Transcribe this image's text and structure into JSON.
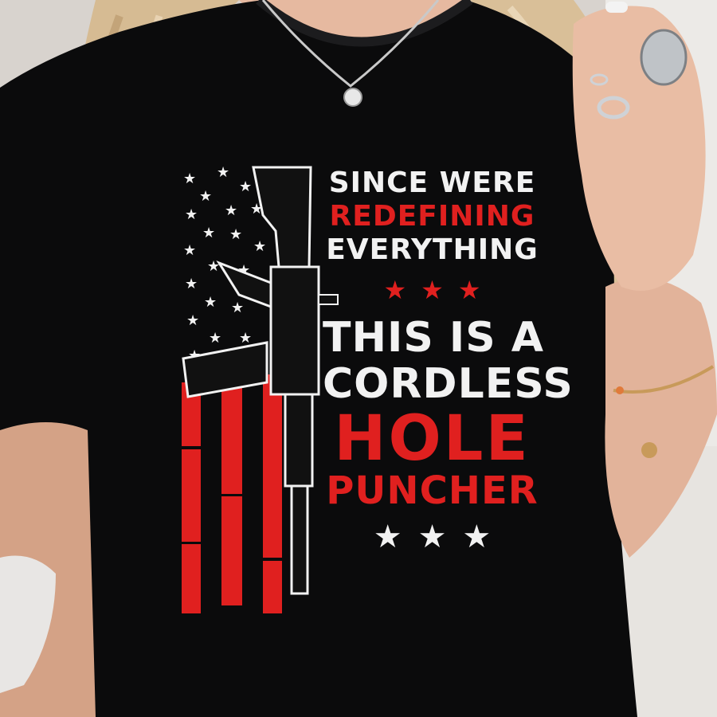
{
  "shirt": {
    "lines": [
      "SINCE WERE",
      "REDEFINING",
      "EVERYTHING",
      "THIS IS A",
      "CORDLESS",
      "HOLE",
      "PUNCHER"
    ],
    "divider_stars": "★★★",
    "bottom_stars": "★★★"
  },
  "colors": {
    "shirt": "#0b0b0c",
    "print_white": "#f2f2f2",
    "print_red": "#e0201f",
    "skin": "#e2b39a",
    "hair": "#d9bf98",
    "background": "#d9d4cf"
  }
}
